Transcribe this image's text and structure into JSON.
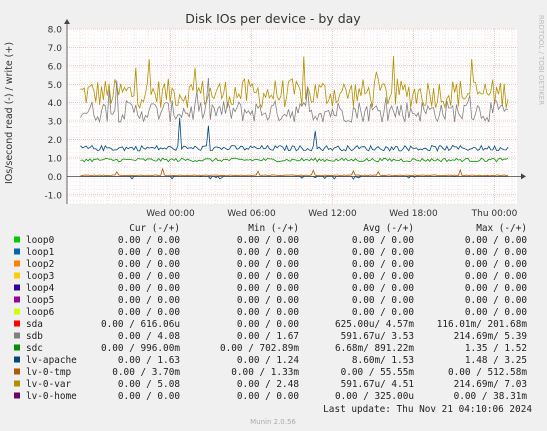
{
  "chart_data": {
    "type": "line",
    "title": "Disk IOs per device - by day",
    "ylabel": "IOs/second read (-) / write (+)",
    "watermark": "RRDTOOL / TOBI OETIKER",
    "footer": "Munin 2.0.56",
    "last_update": "Last update: Thu Nov 21 04:10:06 2024",
    "ylim": [
      -1.5,
      8.0
    ],
    "yticks": [
      "8.0",
      "7.0",
      "6.0",
      "5.0",
      "4.0",
      "3.0",
      "2.0",
      "1.0",
      "0.0",
      "-1.0"
    ],
    "xticks": [
      {
        "label": "Wed 00:00",
        "t": 0.23
      },
      {
        "label": "Wed 06:00",
        "t": 0.41
      },
      {
        "label": "Wed 12:00",
        "t": 0.59
      },
      {
        "label": "Wed 18:00",
        "t": 0.77
      },
      {
        "label": "Thu 00:00",
        "t": 0.95
      }
    ],
    "grid": true,
    "legend_header": [
      "Cur (-/+)",
      "Min (-/+)",
      "Avg (-/+)",
      "Max (-/+)"
    ],
    "series": [
      {
        "name": "loop0",
        "color": "#00cc00",
        "cur": "0.00 /   0.00",
        "min": "0.00 /   0.00",
        "avg": "0.00 /   0.00",
        "max": "0.00 /   0.00"
      },
      {
        "name": "loop1",
        "color": "#0066b3",
        "cur": "0.00 /   0.00",
        "min": "0.00 /   0.00",
        "avg": "0.00 /   0.00",
        "max": "0.00 /   0.00"
      },
      {
        "name": "loop2",
        "color": "#ff8000",
        "cur": "0.00 /   0.00",
        "min": "0.00 /   0.00",
        "avg": "0.00 /   0.00",
        "max": "0.00 /   0.00"
      },
      {
        "name": "loop3",
        "color": "#ffcc00",
        "cur": "0.00 /   0.00",
        "min": "0.00 /   0.00",
        "avg": "0.00 /   0.00",
        "max": "0.00 /   0.00"
      },
      {
        "name": "loop4",
        "color": "#330099",
        "cur": "0.00 /   0.00",
        "min": "0.00 /   0.00",
        "avg": "0.00 /   0.00",
        "max": "0.00 /   0.00"
      },
      {
        "name": "loop5",
        "color": "#990099",
        "cur": "0.00 /   0.00",
        "min": "0.00 /   0.00",
        "avg": "0.00 /   0.00",
        "max": "0.00 /   0.00"
      },
      {
        "name": "loop6",
        "color": "#ccff00",
        "cur": "0.00 /   0.00",
        "min": "0.00 /   0.00",
        "avg": "0.00 /   0.00",
        "max": "0.00 /   0.00"
      },
      {
        "name": "sda",
        "color": "#ff0000",
        "cur": "0.00 / 616.06u",
        "min": "0.00 /   0.00",
        "avg": "625.00u/   4.57m",
        "max": "116.01m/ 201.68m"
      },
      {
        "name": "sdb",
        "color": "#808080",
        "cur": "0.00 /   4.08",
        "min": "0.00 /   1.67",
        "avg": "591.67u/   3.53",
        "max": "214.69m/   5.39"
      },
      {
        "name": "sdc",
        "color": "#008f00",
        "cur": "0.00 / 996.00m",
        "min": "0.00 / 702.89m",
        "avg": "6.68m/ 891.22m",
        "max": "1.35 /   1.52"
      },
      {
        "name": "lv-apache",
        "color": "#00487d",
        "cur": "0.00 /   1.63",
        "min": "0.00 /   1.24",
        "avg": "8.60m/   1.53",
        "max": "1.48 /   3.25"
      },
      {
        "name": "lv-0-tmp",
        "color": "#b35a00",
        "cur": "0.00 /   3.70m",
        "min": "0.00 /   1.33m",
        "avg": "0.00 /  55.55m",
        "max": "0.00 / 512.58m"
      },
      {
        "name": "lv-0-var",
        "color": "#b38f00",
        "cur": "0.00 /   5.08",
        "min": "0.00 /   2.48",
        "avg": "591.67u/   4.51",
        "max": "214.69m/   7.03"
      },
      {
        "name": "lv-0-home",
        "color": "#6b006b",
        "cur": "0.00 /   0.00",
        "min": "0.00 /   0.00",
        "avg": "0.00 / 325.00u",
        "max": "0.00 /  38.31m"
      }
    ]
  }
}
